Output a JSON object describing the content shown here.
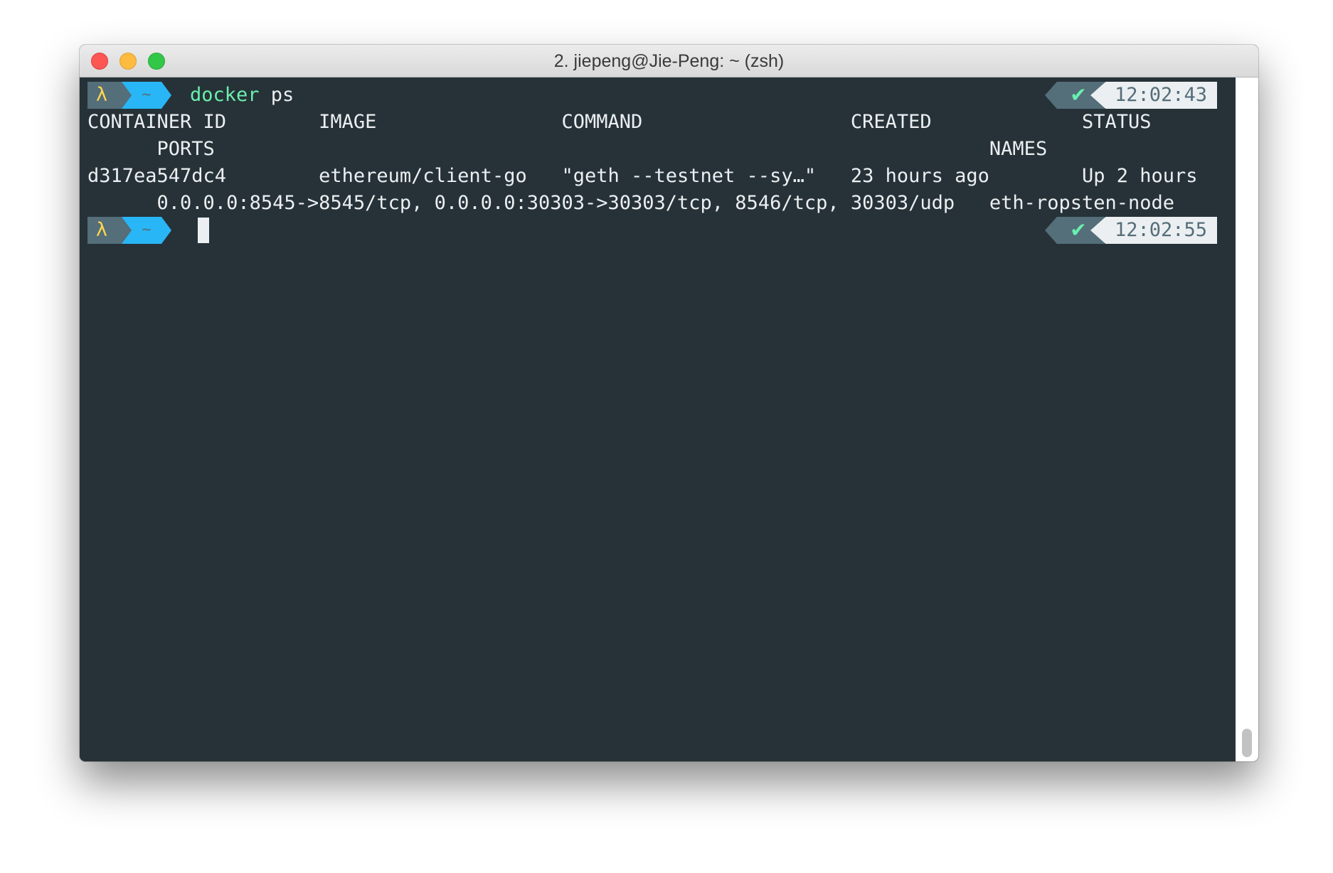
{
  "window": {
    "title": "2. jiepeng@Jie-Peng: ~ (zsh)"
  },
  "prompt": {
    "lambda": "λ",
    "path": "~",
    "status_icon": "✔",
    "status_icon_name": "checkmark-icon"
  },
  "session": [
    {
      "command_name": "docker",
      "command_args": " ps",
      "time": "12:02:43"
    },
    {
      "command_name": "",
      "command_args": "",
      "time": "12:02:55"
    }
  ],
  "output": {
    "header_line_1": "CONTAINER ID        IMAGE                COMMAND                  CREATED             STATUS",
    "header_line_2": "      PORTS                                                                   NAMES",
    "row_line_1": "d317ea547dc4        ethereum/client-go   \"geth --testnet --sy…\"   23 hours ago        Up 2 hours",
    "row_line_2": "      0.0.0.0:8545->8545/tcp, 0.0.0.0:30303->30303/tcp, 8546/tcp, 30303/udp   eth-ropsten-node"
  },
  "colors": {
    "background": "#263238",
    "prompt_segment": "#546e7a",
    "path_segment": "#29b6f6",
    "lambda": "#ffd54f",
    "command": "#69f0ae",
    "text": "#eceff1"
  }
}
